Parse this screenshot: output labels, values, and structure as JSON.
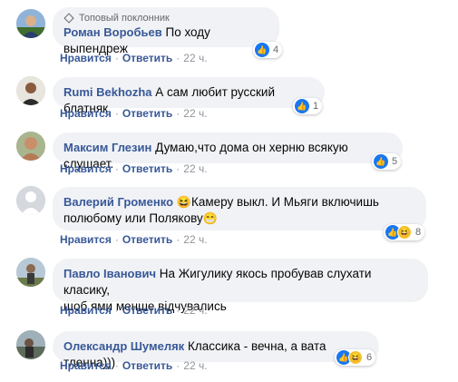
{
  "colors": {
    "accent": "#385898",
    "bubble": "#f0f2f5",
    "like": "#1877f2",
    "haha": "#f7c12c"
  },
  "actions": {
    "like": "Нравится",
    "reply": "Ответить",
    "sep": "·"
  },
  "comments": [
    {
      "badge": "Топовый поклонник",
      "name": "Роман Воробьев",
      "text": "По ходу выпендреж",
      "time": "22 ч.",
      "reactions": "4",
      "reaction_types": [
        "like-icon"
      ]
    },
    {
      "name": "Rumi Bekhozha",
      "text": "А сам любит русский блатняк",
      "time": "22 ч.",
      "reactions": "1",
      "reaction_types": [
        "like-icon"
      ]
    },
    {
      "name": "Максим Глезин",
      "text": "Думаю,что дома он херню всякую слушает.",
      "time": "22 ч.",
      "reactions": "5",
      "reaction_types": [
        "like-icon"
      ]
    },
    {
      "name": "Валерий Громенко",
      "text_emoji1": "😆",
      "text_a": "Камеру выкл. И Мьяги включишь",
      "text_b": "полюбому или Полякову",
      "text_emoji2": "😁",
      "time": "22 ч.",
      "reactions": "8",
      "reaction_types": [
        "like-icon",
        "haha-icon"
      ]
    },
    {
      "name": "Павло Іванович",
      "text_a": "На Жигулику якось пробував слухати класику,",
      "text_b": "щоб ями менше відчувались",
      "time": "22 ч."
    },
    {
      "name": "Олександр Шумеляк",
      "text": "Классика - вечна, а вата тленна)))",
      "time": "22 ч.",
      "reactions": "6",
      "reaction_types": [
        "like-icon",
        "haha-icon"
      ]
    }
  ]
}
